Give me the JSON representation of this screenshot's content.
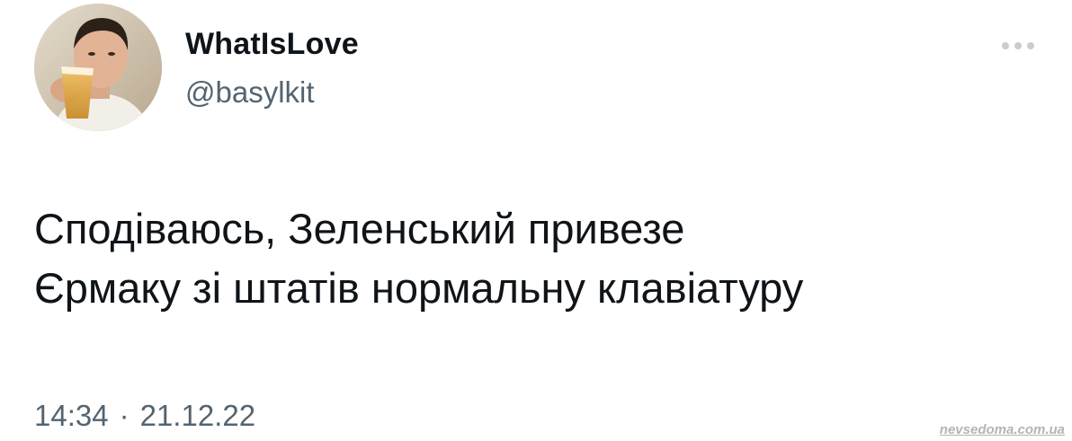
{
  "author": {
    "display_name": "WhatIsLove",
    "handle": "@basylkit",
    "avatar_icon": "user-avatar-photo"
  },
  "more_icon": "more-horizontal-icon",
  "tweet": {
    "lines": [
      "Сподіваюсь, Зеленський привезе",
      "Єрмаку зі штатів нормальну клавіатуру"
    ]
  },
  "meta": {
    "time": "14:34",
    "separator": "·",
    "date": "21.12.22"
  },
  "watermark": "nevsedoma.com.ua",
  "colors": {
    "text_primary": "#0f1419",
    "text_secondary": "#536471",
    "background": "#ffffff"
  }
}
